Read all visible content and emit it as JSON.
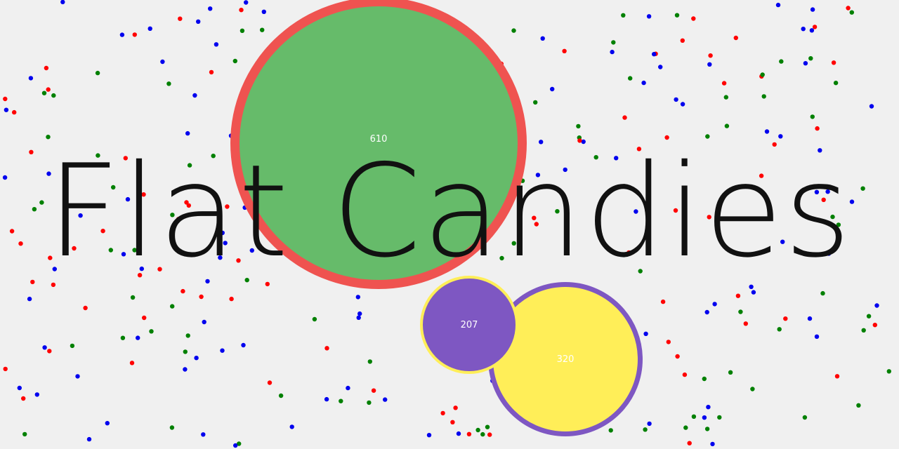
{
  "game": {
    "title": "Flat Candies",
    "background_color": "#f0f0f0",
    "pellet_colors": [
      "#ff0000",
      "#0000ee",
      "#008000"
    ]
  },
  "cells": [
    {
      "id": "green",
      "mass": "610",
      "fill": "#66bb6a",
      "border": "#ef5350"
    },
    {
      "id": "yellow",
      "mass": "320",
      "fill": "#ffee58",
      "border": "#7e57c2"
    },
    {
      "id": "purple",
      "mass": "207",
      "fill": "#7e57c2",
      "border": "#ffee58"
    }
  ]
}
